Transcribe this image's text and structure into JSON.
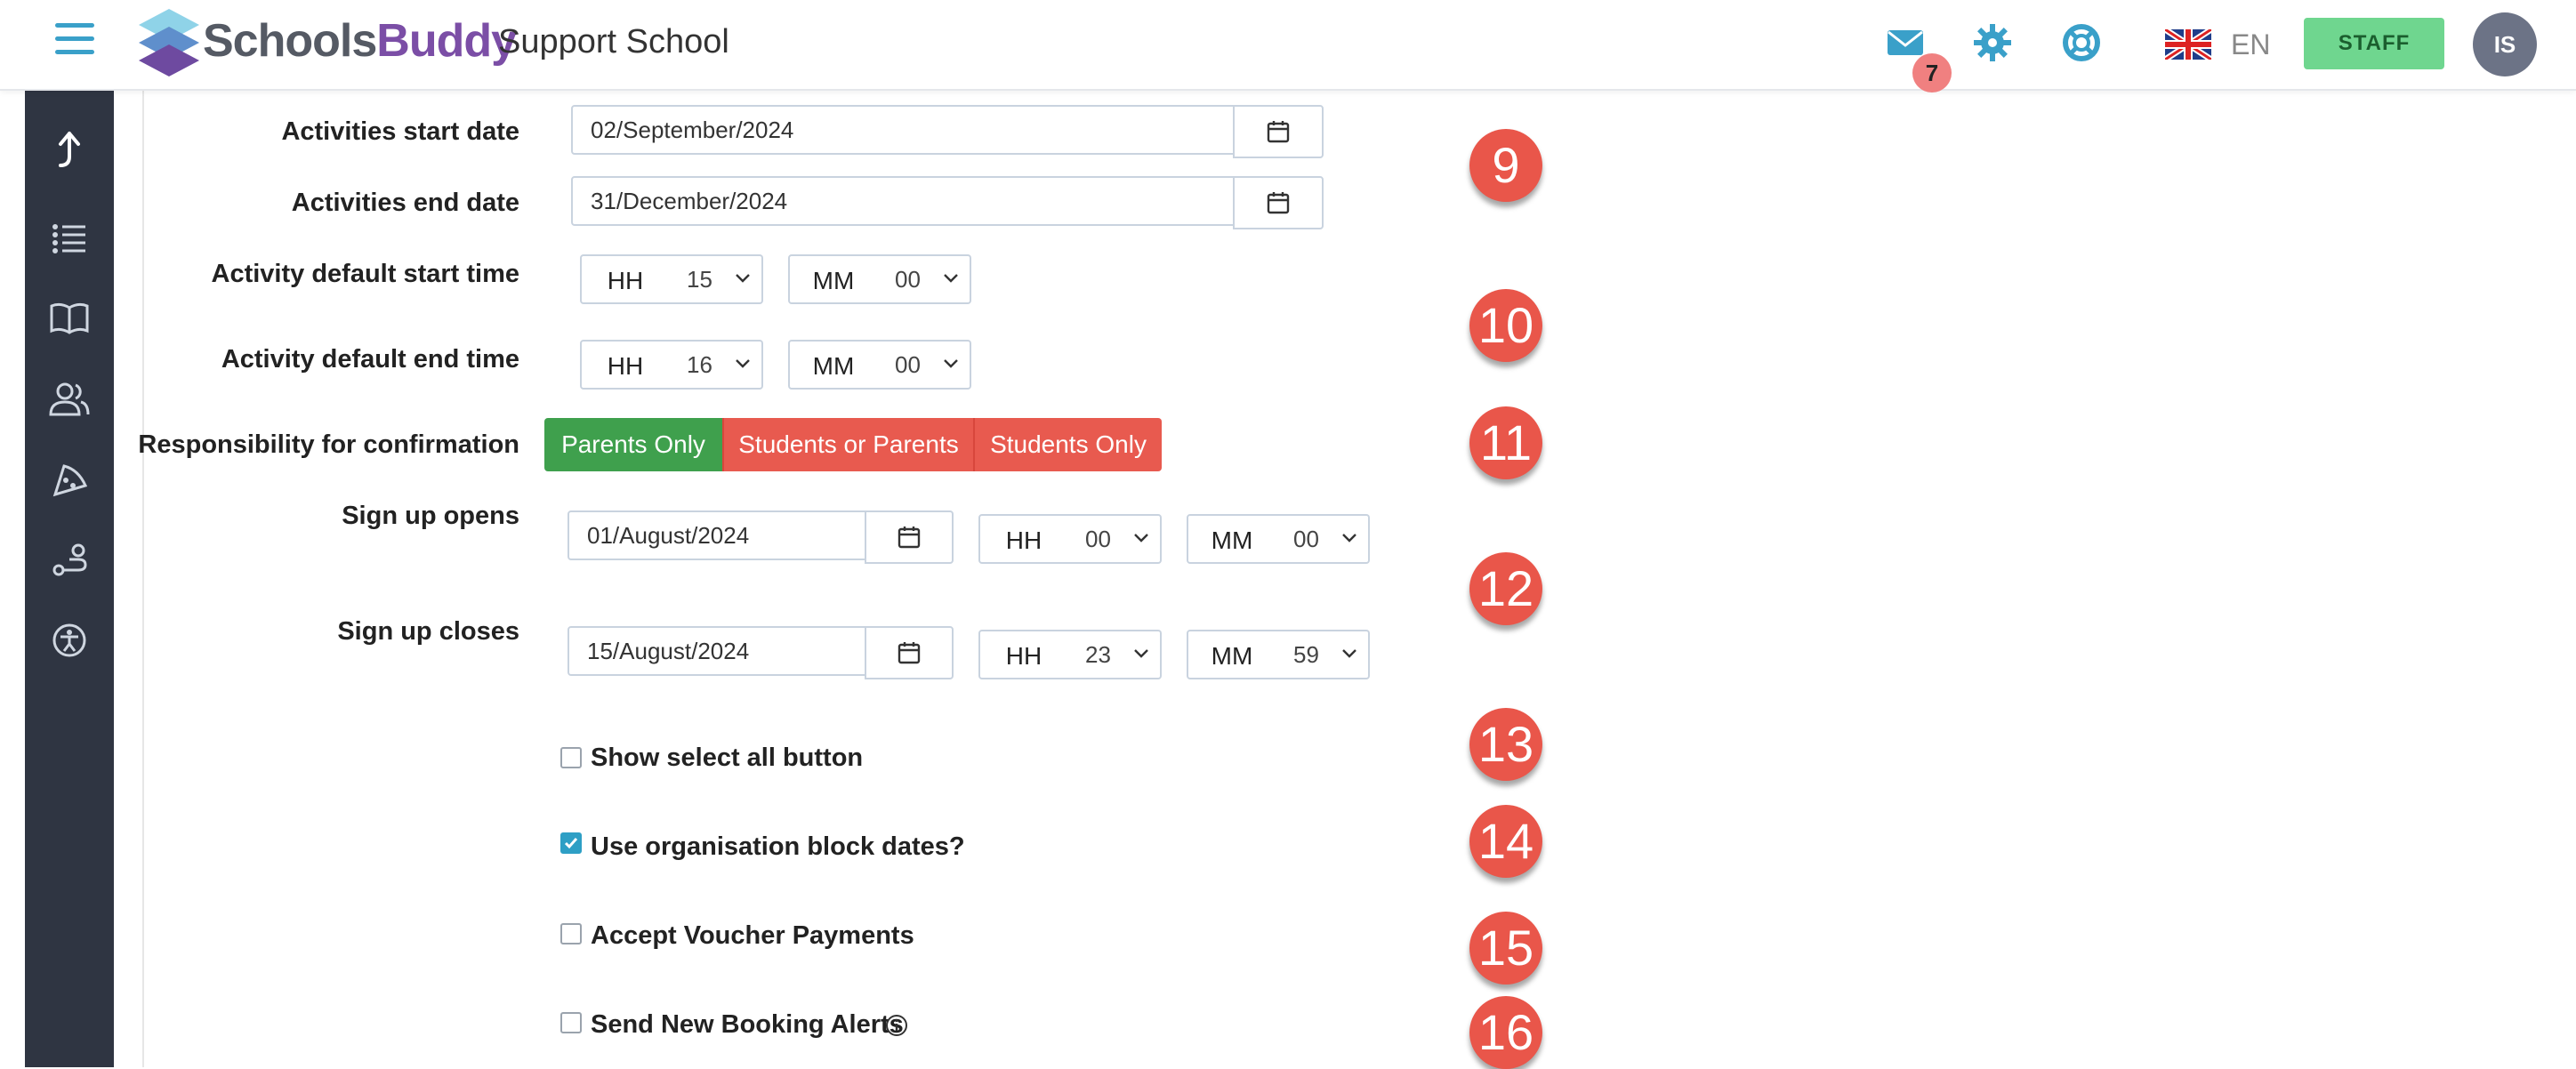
{
  "header": {
    "brand_first": "Schools",
    "brand_second": "Buddy",
    "school_name": "Support School",
    "mail_count": "7",
    "language": "EN",
    "staff_label": "STAFF",
    "avatar_initials": "IS",
    "colors": {
      "accent": "#3aa0c9",
      "staff": "#6fd68f",
      "sidebar": "#2f3542"
    }
  },
  "sidebar": {
    "items": [
      {
        "icon": "arrow-up-icon"
      },
      {
        "icon": "list-icon"
      },
      {
        "icon": "book-icon"
      },
      {
        "icon": "users-icon"
      },
      {
        "icon": "pizza-icon"
      },
      {
        "icon": "route-icon"
      },
      {
        "icon": "accessibility-icon"
      }
    ]
  },
  "form": {
    "activities_start": {
      "label": "Activities start date",
      "value": "02/September/2024"
    },
    "activities_end": {
      "label": "Activities end date",
      "value": "31/December/2024"
    },
    "default_start_time": {
      "label": "Activity default start time",
      "hh_label": "HH",
      "hh": "15",
      "mm_label": "MM",
      "mm": "00"
    },
    "default_end_time": {
      "label": "Activity default end time",
      "hh_label": "HH",
      "hh": "16",
      "mm_label": "MM",
      "mm": "00"
    },
    "responsibility": {
      "label": "Responsibility for confirmation",
      "options": [
        "Parents Only",
        "Students or Parents",
        "Students Only"
      ],
      "selected": "Parents Only"
    },
    "signup_opens": {
      "label": "Sign up opens",
      "date": "01/August/2024",
      "hh_label": "HH",
      "hh": "00",
      "mm_label": "MM",
      "mm": "00"
    },
    "signup_closes": {
      "label": "Sign up closes",
      "date": "15/August/2024",
      "hh_label": "HH",
      "hh": "23",
      "mm_label": "MM",
      "mm": "59"
    },
    "checkboxes": [
      {
        "label": "Show select all button",
        "checked": false
      },
      {
        "label": "Use organisation block dates?",
        "checked": true
      },
      {
        "label": "Accept Voucher Payments",
        "checked": false
      },
      {
        "label": "Send New Booking Alerts",
        "checked": false
      }
    ]
  },
  "markers": [
    "9",
    "10",
    "11",
    "12",
    "13",
    "14",
    "15",
    "16"
  ]
}
